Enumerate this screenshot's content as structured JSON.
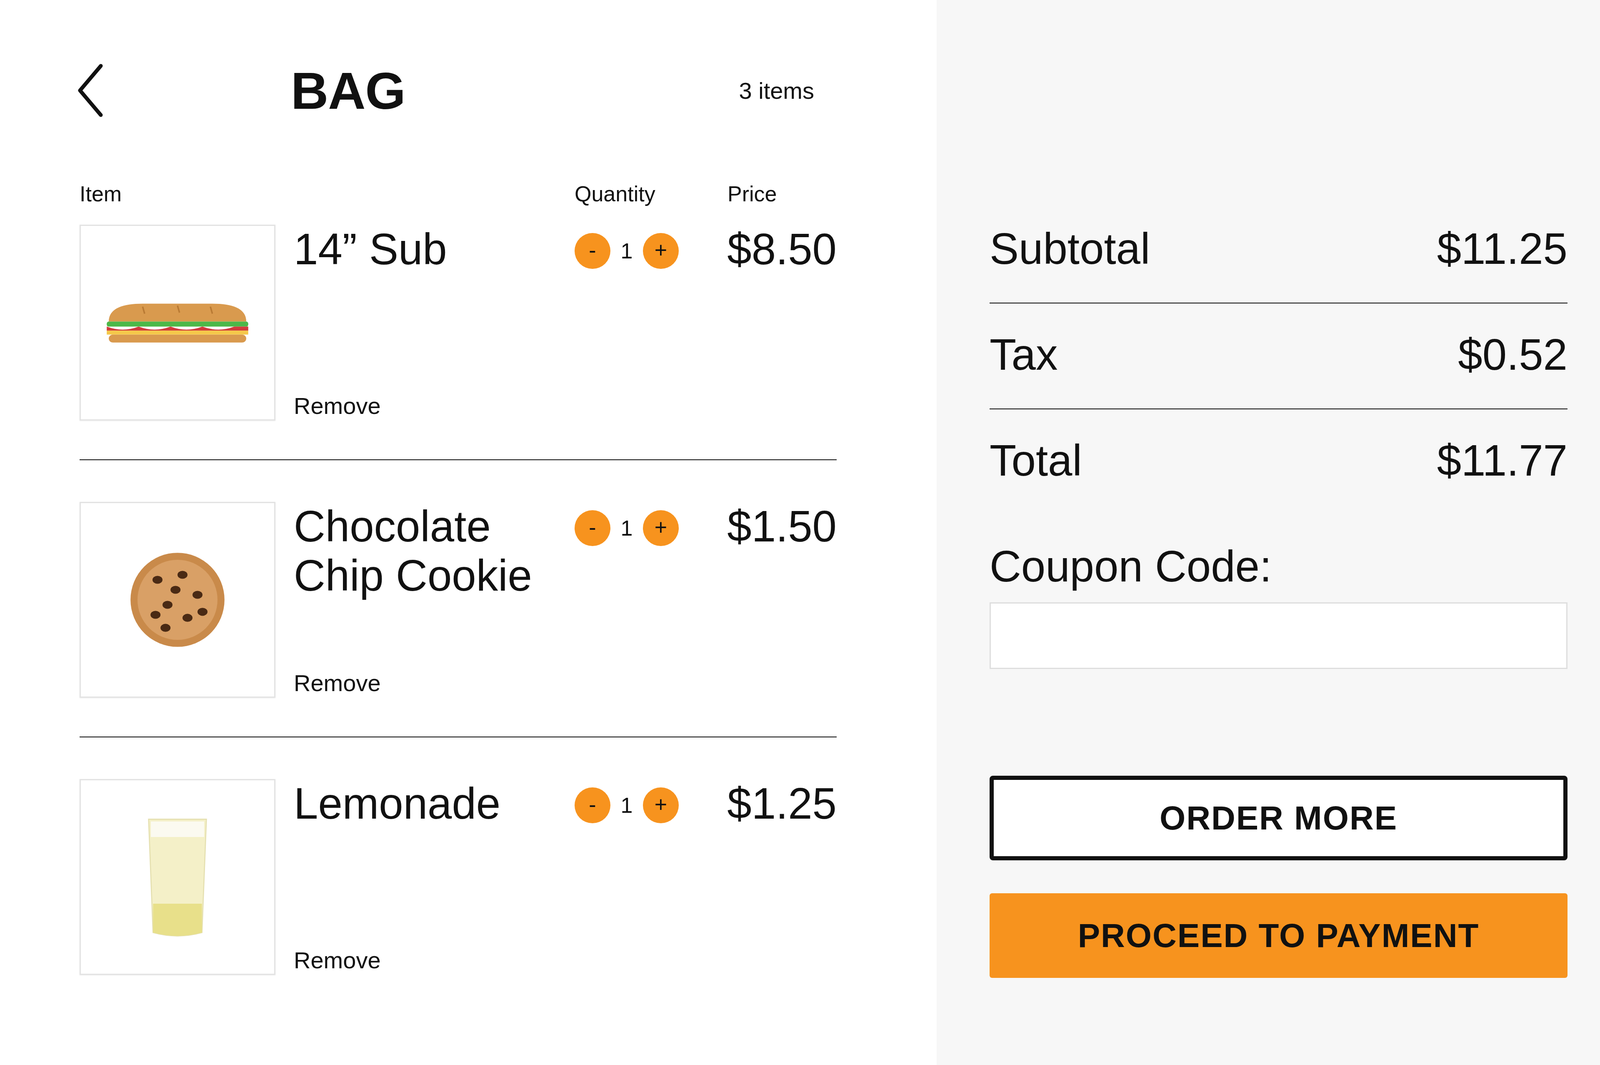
{
  "header": {
    "title": "BAG",
    "count": "3 items"
  },
  "columns": [
    "Item",
    "Quantity",
    "Price"
  ],
  "stepper": {
    "decrement": "-",
    "increment": "+"
  },
  "items": [
    {
      "name": "14” Sub",
      "quantity": "1",
      "price": "$8.50",
      "remove": "Remove",
      "kind": "sub"
    },
    {
      "name": "Chocolate Chip Cookie",
      "quantity": "1",
      "price": "$1.50",
      "remove": "Remove",
      "kind": "cookie"
    },
    {
      "name": "Lemonade",
      "quantity": "1",
      "price": "$1.25",
      "remove": "Remove",
      "kind": "drink"
    }
  ],
  "summary": [
    {
      "label": "Subtotal",
      "value": "$11.25"
    },
    {
      "label": "Tax",
      "value": "$0.52"
    },
    {
      "label": "Total",
      "value": "$11.77"
    }
  ],
  "coupon": {
    "label": "Coupon Code:",
    "value": ""
  },
  "buttons": [
    {
      "label": "ORDER MORE",
      "kind": "outline"
    },
    {
      "label": "PROCEED TO PAYMENT",
      "kind": "primary"
    }
  ]
}
